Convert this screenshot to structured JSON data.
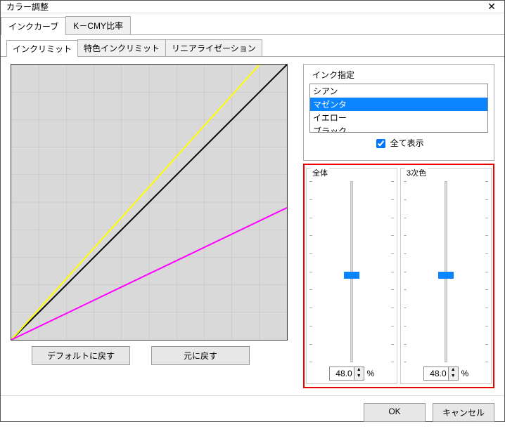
{
  "title": "カラー調整",
  "tabs_outer": [
    {
      "label": "インクカーブ",
      "active": true
    },
    {
      "label": "K－CMY比率",
      "active": false
    }
  ],
  "tabs_inner": [
    {
      "label": "インクリミット",
      "active": true
    },
    {
      "label": "特色インクリミット",
      "active": false
    },
    {
      "label": "リニアライゼーション",
      "active": false
    }
  ],
  "graph_buttons": {
    "default": "デフォルトに戻す",
    "undo": "元に戻す"
  },
  "ink_designation": {
    "legend": "インク指定",
    "items": [
      {
        "label": "シアン",
        "selected": false
      },
      {
        "label": "マゼンタ",
        "selected": true
      },
      {
        "label": "イエロー",
        "selected": false
      },
      {
        "label": "ブラック",
        "selected": false
      }
    ],
    "show_all_label": "全て表示",
    "show_all_checked": true
  },
  "sliders": {
    "overall": {
      "label": "全体",
      "value": "48.0",
      "percent": 48.0,
      "unit": "%"
    },
    "tertiary": {
      "label": "3次色",
      "value": "48.0",
      "percent": 48.0,
      "unit": "%"
    }
  },
  "footer": {
    "ok": "OK",
    "cancel": "キャンセル"
  },
  "chart_data": {
    "type": "line",
    "xlim": [
      0,
      100
    ],
    "ylim": [
      0,
      100
    ],
    "grid": true,
    "series": [
      {
        "name": "black",
        "color": "#000000",
        "points": [
          [
            0,
            0
          ],
          [
            100,
            100
          ]
        ]
      },
      {
        "name": "yellow",
        "color": "#ffff00",
        "points": [
          [
            0,
            0
          ],
          [
            90,
            100
          ]
        ]
      },
      {
        "name": "magenta",
        "color": "#ff00ff",
        "points": [
          [
            0,
            0
          ],
          [
            100,
            48
          ]
        ]
      }
    ]
  }
}
